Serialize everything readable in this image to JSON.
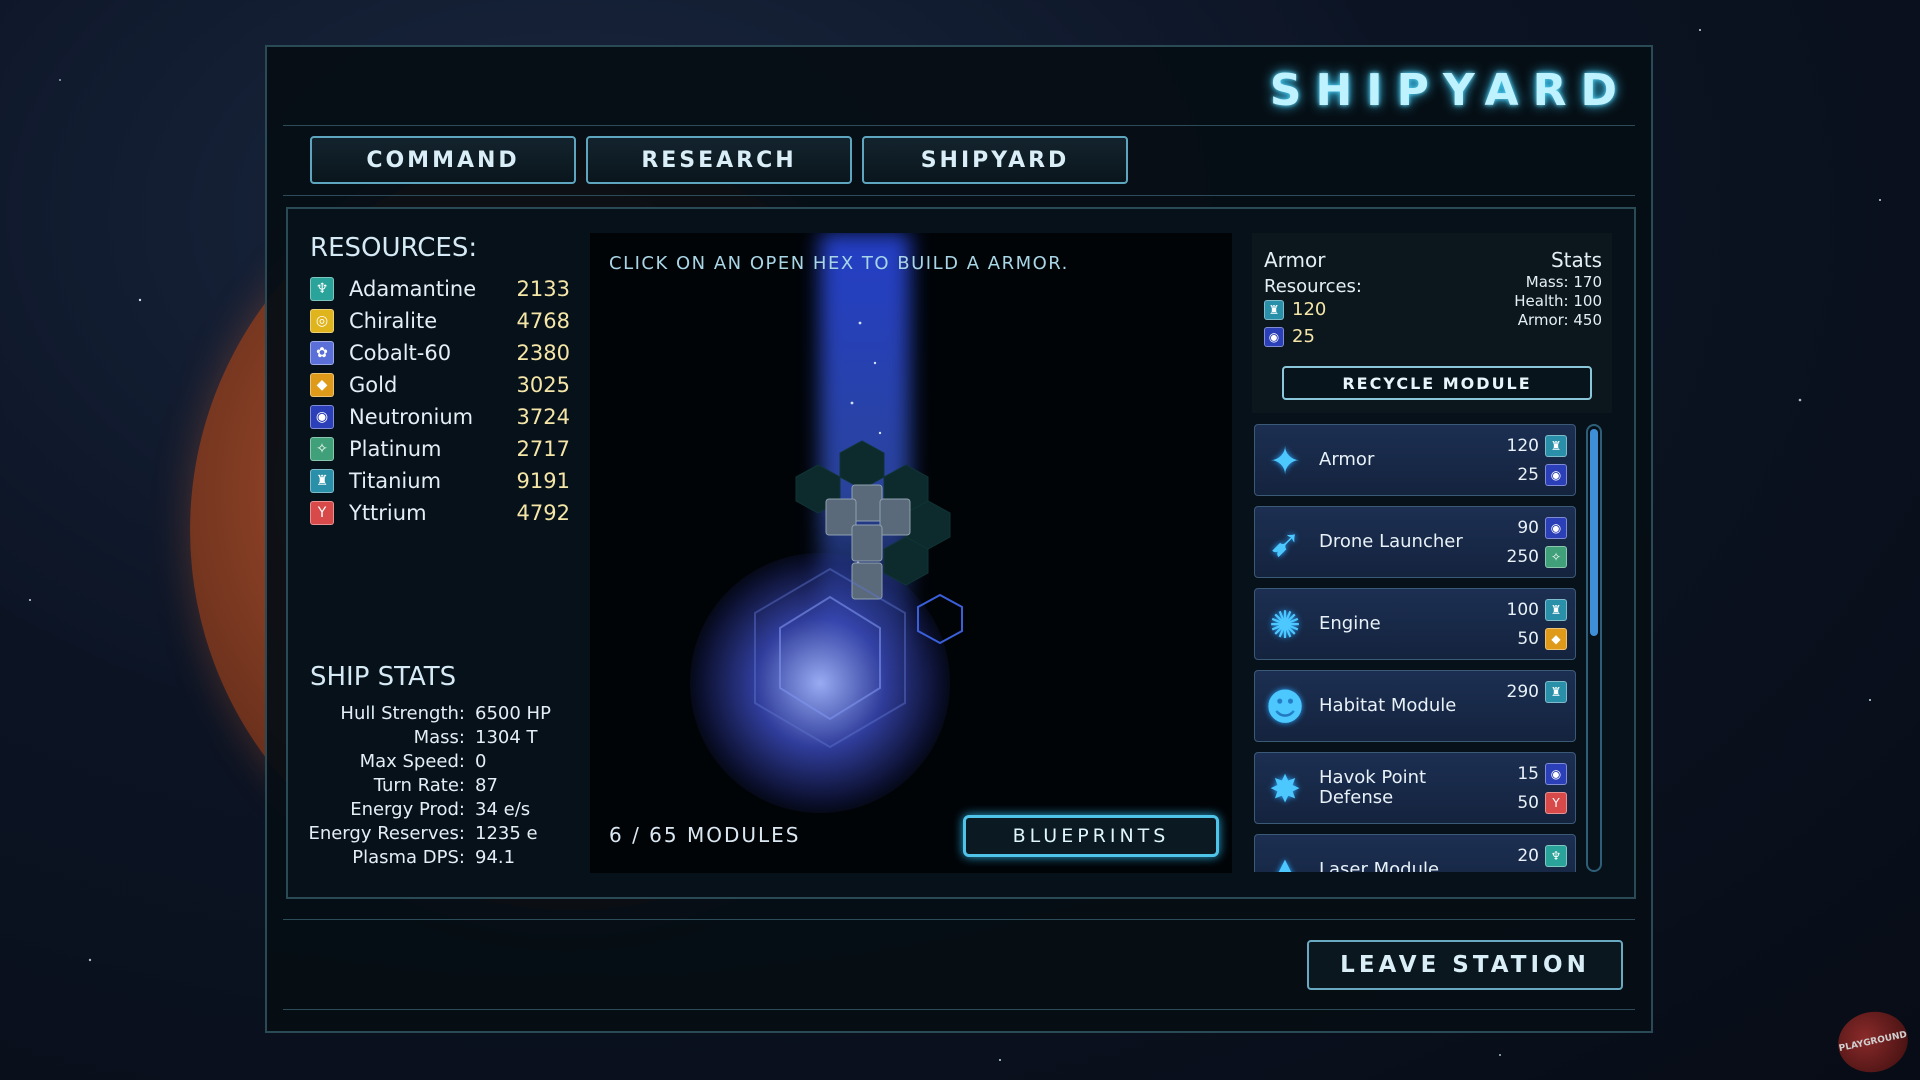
{
  "window": {
    "title": "SHIPYARD"
  },
  "tabs": [
    {
      "label": "COMMAND"
    },
    {
      "label": "RESEARCH"
    },
    {
      "label": "SHIPYARD"
    }
  ],
  "resources": {
    "heading": "RESOURCES:",
    "items": [
      {
        "name": "Adamantine",
        "value": "2133",
        "icon": "adamantine-icon",
        "color": "#2aa39a"
      },
      {
        "name": "Chiralite",
        "value": "4768",
        "icon": "chiralite-icon",
        "color": "#e0b41c"
      },
      {
        "name": "Cobalt-60",
        "value": "2380",
        "icon": "cobalt-icon",
        "color": "#5a6fd8"
      },
      {
        "name": "Gold",
        "value": "3025",
        "icon": "gold-icon",
        "color": "#e09a1a"
      },
      {
        "name": "Neutronium",
        "value": "3724",
        "icon": "neutronium-icon",
        "color": "#2a3fb8"
      },
      {
        "name": "Platinum",
        "value": "2717",
        "icon": "platinum-icon",
        "color": "#3fa07a"
      },
      {
        "name": "Titanium",
        "value": "9191",
        "icon": "titanium-icon",
        "color": "#2a8fa8"
      },
      {
        "name": "Yttrium",
        "value": "4792",
        "icon": "yttrium-icon",
        "color": "#d84a4a"
      }
    ]
  },
  "ship_stats": {
    "heading": "SHIP STATS",
    "items": [
      {
        "label": "Hull Strength:",
        "value": "6500 HP"
      },
      {
        "label": "Mass:",
        "value": "1304 T"
      },
      {
        "label": "Max Speed:",
        "value": "0"
      },
      {
        "label": "Turn Rate:",
        "value": "87"
      },
      {
        "label": "Energy Prod:",
        "value": "34 e/s"
      },
      {
        "label": "Energy Reserves:",
        "value": "1235 e"
      },
      {
        "label": "Plasma DPS:",
        "value": "94.1"
      }
    ]
  },
  "viewport": {
    "hint": "CLICK ON AN OPEN HEX TO BUILD A ARMOR.",
    "module_count": "6 / 65 MODULES",
    "blueprints_label": "BLUEPRINTS"
  },
  "detail": {
    "name": "Armor",
    "stats_label": "Stats",
    "resources_label": "Resources:",
    "mass": "Mass: 170",
    "health": "Health: 100",
    "armor": "Armor: 450",
    "costs": [
      {
        "amount": "120",
        "icon": "titanium-icon",
        "color": "#2a8fa8"
      },
      {
        "amount": "25",
        "icon": "neutronium-icon",
        "color": "#2a3fb8"
      }
    ],
    "recycle_label": "RECYCLE MODULE"
  },
  "modules": [
    {
      "name": "Armor",
      "icon": "armor-icon",
      "glyph": "✦",
      "costs": [
        {
          "amount": "120",
          "icon": "titanium-icon",
          "color": "#2a8fa8"
        },
        {
          "amount": "25",
          "icon": "neutronium-icon",
          "color": "#2a3fb8"
        }
      ]
    },
    {
      "name": "Drone Launcher",
      "icon": "drone-launcher-icon",
      "glyph": "➹",
      "costs": [
        {
          "amount": "90",
          "icon": "neutronium-icon",
          "color": "#2a3fb8"
        },
        {
          "amount": "250",
          "icon": "platinum-icon",
          "color": "#3fa07a"
        }
      ]
    },
    {
      "name": "Engine",
      "icon": "engine-icon",
      "glyph": "✺",
      "costs": [
        {
          "amount": "100",
          "icon": "titanium-icon",
          "color": "#2a8fa8"
        },
        {
          "amount": "50",
          "icon": "gold-icon",
          "color": "#e09a1a"
        }
      ]
    },
    {
      "name": "Habitat Module",
      "icon": "habitat-module-icon",
      "glyph": "☻",
      "costs": [
        {
          "amount": "290",
          "icon": "titanium-icon",
          "color": "#2a8fa8"
        }
      ]
    },
    {
      "name": "Havok Point Defense",
      "icon": "havok-point-defense-icon",
      "glyph": "✸",
      "costs": [
        {
          "amount": "15",
          "icon": "neutronium-icon",
          "color": "#2a3fb8"
        },
        {
          "amount": "50",
          "icon": "yttrium-icon",
          "color": "#d84a4a"
        }
      ]
    },
    {
      "name": "Laser Module",
      "icon": "laser-module-icon",
      "glyph": "▲",
      "costs": [
        {
          "amount": "20",
          "icon": "adamantine-icon",
          "color": "#2aa39a"
        }
      ]
    }
  ],
  "scroll_fraction": 0.47,
  "footer": {
    "leave_label": "LEAVE STATION"
  },
  "logo_text": "PLAYGROUND"
}
